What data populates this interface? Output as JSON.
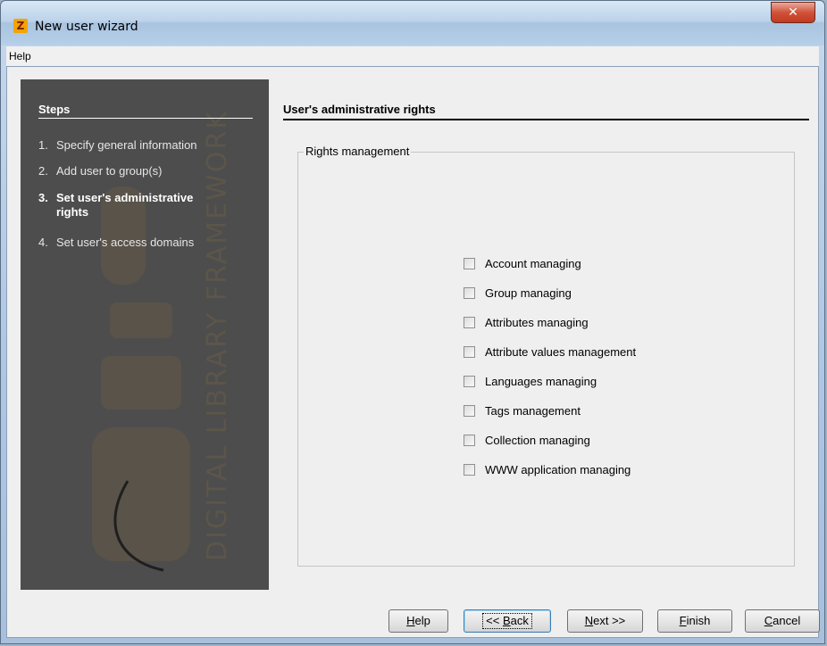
{
  "window": {
    "title": "New user wizard",
    "icon_glyph": "Z",
    "close_glyph": "✕"
  },
  "menu": {
    "help": "Help"
  },
  "sidebar": {
    "title": "Steps",
    "steps": [
      {
        "num": "1.",
        "label": "Specify general information",
        "active": false
      },
      {
        "num": "2.",
        "label": "Add user to group(s)",
        "active": false
      },
      {
        "num": "3.",
        "label": "Set user's administrative rights",
        "active": true
      },
      {
        "num": "4.",
        "label": "Set user's access domains",
        "active": false
      }
    ],
    "watermark_text": "DIGITAL LIBRARY FRAMEWORK"
  },
  "main": {
    "title": "User's administrative rights",
    "group_label": "Rights management",
    "rights": [
      {
        "label": "Account managing",
        "checked": false
      },
      {
        "label": "Group managing",
        "checked": false
      },
      {
        "label": "Attributes managing",
        "checked": false
      },
      {
        "label": "Attribute values management",
        "checked": false
      },
      {
        "label": "Languages managing",
        "checked": false
      },
      {
        "label": "Tags management",
        "checked": false
      },
      {
        "label": "Collection managing",
        "checked": false
      },
      {
        "label": "WWW application managing",
        "checked": false
      }
    ]
  },
  "buttons": {
    "help": {
      "mnemonic": "H",
      "rest": "elp"
    },
    "back": {
      "prefix": "<< ",
      "mnemonic": "B",
      "rest": "ack"
    },
    "next": {
      "mnemonic": "N",
      "rest": "ext >>"
    },
    "finish": {
      "mnemonic": "F",
      "rest": "inish"
    },
    "cancel": {
      "mnemonic": "C",
      "rest": "ancel"
    }
  },
  "colors": {
    "sidebar_bg": "#4d4d4d",
    "watermark": "#5c5549"
  }
}
